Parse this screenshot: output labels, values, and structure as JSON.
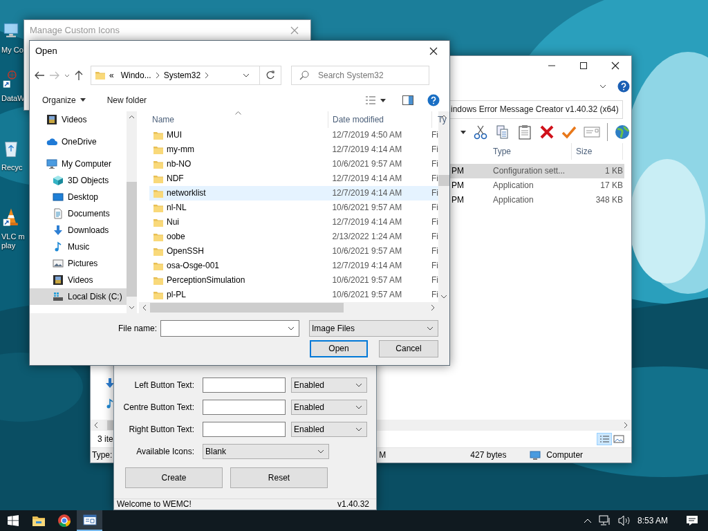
{
  "desktop_icons": [
    {
      "label": "My Co",
      "kind": "computer"
    },
    {
      "label": "DataW",
      "kind": "shortcut"
    },
    {
      "label": "Recyc",
      "kind": "recycle"
    },
    {
      "label": "VLC m play",
      "kind": "cone"
    }
  ],
  "explorer_window": {
    "address": "indows Error Message Creator v1.40.32 (x64)",
    "columns": [
      "Type",
      "Size"
    ],
    "rows": [
      {
        "column_1": "PM",
        "type": "Configuration sett...",
        "size": "1 KB",
        "selected": true
      },
      {
        "column_1": "PM",
        "type": "Application",
        "size": "17 KB",
        "selected": false
      },
      {
        "column_1": "PM",
        "type": "Application",
        "size": "348 KB",
        "selected": false
      }
    ],
    "item_count": "3 ite",
    "status_bar": {
      "type_label": "Type:",
      "column_2": "M",
      "size": "427 bytes",
      "location": "Computer"
    }
  },
  "manage_icons_window": {
    "title": "Manage Custom Icons"
  },
  "open_dialog": {
    "title": "Open",
    "breadcrumb_overflow": "«",
    "breadcrumbs": [
      "Windo...",
      "System32"
    ],
    "search": {
      "placeholder": "Search System32"
    },
    "toolbar": {
      "organize": "Organize",
      "new_folder": "New folder"
    },
    "tree": [
      {
        "label": "Videos",
        "kind": "video",
        "selected": false
      },
      {
        "label": "OneDrive",
        "kind": "cloud",
        "selected": false
      },
      {
        "label": "My Computer",
        "kind": "computer",
        "selected": false,
        "children": [
          {
            "label": "3D Objects",
            "kind": "cube",
            "selected": false
          },
          {
            "label": "Desktop",
            "kind": "desktop",
            "selected": false
          },
          {
            "label": "Documents",
            "kind": "document",
            "selected": false
          },
          {
            "label": "Downloads",
            "kind": "download",
            "selected": false
          },
          {
            "label": "Music",
            "kind": "music",
            "selected": false
          },
          {
            "label": "Pictures",
            "kind": "picture",
            "selected": false
          },
          {
            "label": "Videos",
            "kind": "video",
            "selected": false
          },
          {
            "label": "Local Disk (C:)",
            "kind": "drive",
            "selected": true
          }
        ]
      }
    ],
    "columns": [
      "Name",
      "Date modified",
      "Ty"
    ],
    "files": [
      {
        "name": "MUI",
        "date": "12/7/2019 4:50 AM",
        "type": "Fi",
        "selected": false
      },
      {
        "name": "my-mm",
        "date": "12/7/2019 4:14 AM",
        "type": "Fi",
        "selected": false
      },
      {
        "name": "nb-NO",
        "date": "10/6/2021 9:57 AM",
        "type": "Fi",
        "selected": false
      },
      {
        "name": "NDF",
        "date": "12/7/2019 4:14 AM",
        "type": "Fi",
        "selected": false
      },
      {
        "name": "networklist",
        "date": "12/7/2019 4:14 AM",
        "type": "Fi",
        "selected": true
      },
      {
        "name": "nl-NL",
        "date": "10/6/2021 9:57 AM",
        "type": "Fi",
        "selected": false
      },
      {
        "name": "Nui",
        "date": "12/7/2019 4:14 AM",
        "type": "Fi",
        "selected": false
      },
      {
        "name": "oobe",
        "date": "2/13/2022 1:24 AM",
        "type": "Fi",
        "selected": false
      },
      {
        "name": "OpenSSH",
        "date": "10/6/2021 9:57 AM",
        "type": "Fi",
        "selected": false
      },
      {
        "name": "osa-Osge-001",
        "date": "12/7/2019 4:14 AM",
        "type": "Fi",
        "selected": false
      },
      {
        "name": "PerceptionSimulation",
        "date": "10/6/2021 9:57 AM",
        "type": "Fi",
        "selected": false
      },
      {
        "name": "pl-PL",
        "date": "10/6/2021 9:57 AM",
        "type": "Fi",
        "selected": false
      }
    ],
    "file_name_label": "File name:",
    "file_type": "Image Files",
    "buttons": [
      {
        "label": "Open",
        "default": true
      },
      {
        "label": "Cancel",
        "default": false
      }
    ]
  },
  "wemc_window": {
    "button_rows": [
      {
        "label": "Left Button Text:",
        "state": "Enabled"
      },
      {
        "label": "Centre Button Text:",
        "state": "Enabled"
      },
      {
        "label": "Right Button Text:",
        "state": "Enabled"
      }
    ],
    "icons_label": "Available Icons:",
    "icon_choice": "Blank",
    "buttons": [
      "Create",
      "Reset"
    ],
    "status": "Welcome to WEMC!",
    "version": "v1.40.32"
  },
  "taskbar": {
    "apps": [
      {
        "kind": "explorer",
        "selected": false
      },
      {
        "kind": "browser",
        "selected": false
      },
      {
        "kind": "app-window",
        "selected": true
      }
    ],
    "time": "8:53 AM"
  }
}
